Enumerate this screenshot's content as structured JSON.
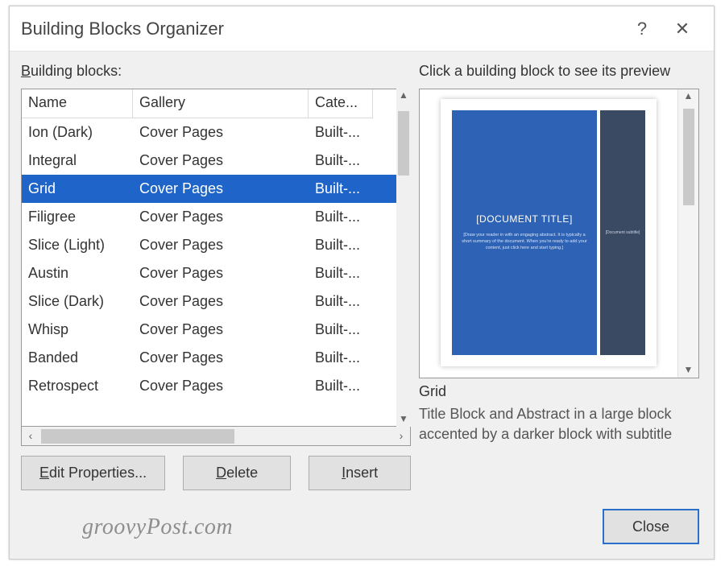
{
  "dialog": {
    "title": "Building Blocks Organizer",
    "help_label": "?",
    "close_x_label": "✕"
  },
  "labels": {
    "list": "Building blocks:",
    "preview": "Click a building block to see its preview"
  },
  "columns": {
    "name": "Name",
    "gallery": "Gallery",
    "category": "Cate..."
  },
  "rows": [
    {
      "name": "Ion (Dark)",
      "gallery": "Cover Pages",
      "category": "Built-...",
      "selected": false
    },
    {
      "name": "Integral",
      "gallery": "Cover Pages",
      "category": "Built-...",
      "selected": false
    },
    {
      "name": "Grid",
      "gallery": "Cover Pages",
      "category": "Built-...",
      "selected": true
    },
    {
      "name": "Filigree",
      "gallery": "Cover Pages",
      "category": "Built-...",
      "selected": false
    },
    {
      "name": "Slice (Light)",
      "gallery": "Cover Pages",
      "category": "Built-...",
      "selected": false
    },
    {
      "name": "Austin",
      "gallery": "Cover Pages",
      "category": "Built-...",
      "selected": false
    },
    {
      "name": "Slice (Dark)",
      "gallery": "Cover Pages",
      "category": "Built-...",
      "selected": false
    },
    {
      "name": "Whisp",
      "gallery": "Cover Pages",
      "category": "Built-...",
      "selected": false
    },
    {
      "name": "Banded",
      "gallery": "Cover Pages",
      "category": "Built-...",
      "selected": false
    },
    {
      "name": "Retrospect",
      "gallery": "Cover Pages",
      "category": "Built-...",
      "selected": false
    }
  ],
  "buttons": {
    "edit": "Edit Properties...",
    "delete": "Delete",
    "insert": "Insert",
    "close": "Close"
  },
  "preview": {
    "name": "Grid",
    "description": "Title Block and Abstract in a large block accented by a darker block with subtitle",
    "doc_title": "[DOCUMENT TITLE]",
    "abstract": "[Draw your reader in with an engaging abstract. It is typically a short summary of the document. When you're ready to add your content, just click here and start typing.]",
    "subtitle": "[Document subtitle]"
  },
  "watermark": "groovyPost.com"
}
